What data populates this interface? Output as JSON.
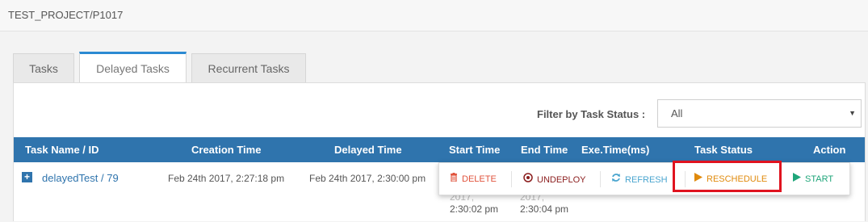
{
  "breadcrumb": "TEST_PROJECT/P1017",
  "tabs": [
    {
      "label": "Tasks",
      "active": false
    },
    {
      "label": "Delayed Tasks",
      "active": true
    },
    {
      "label": "Recurrent Tasks",
      "active": false
    }
  ],
  "filter": {
    "label": "Filter by Task Status :",
    "value": "All"
  },
  "table": {
    "headers": [
      "Task Name / ID",
      "Creation Time",
      "Delayed Time",
      "Start Time",
      "End Time",
      "Exe.Time(ms)",
      "Task Status",
      "Action"
    ],
    "rows": [
      {
        "task_name": "delayedTest",
        "separator": " / ",
        "task_id": "79",
        "creation_time": "Feb 24th 2017, 2:27:18 pm",
        "delayed_time": "Feb 24th 2017, 2:30:00 pm",
        "start_time_line1": "2017,",
        "start_time_line2": "2:30:02 pm",
        "end_time_line1": "2017,",
        "end_time_line2": "2:30:04 pm"
      }
    ]
  },
  "action_menu": {
    "delete": "DELETE",
    "undeploy": "UNDEPLOY",
    "refresh": "REFRESH",
    "reschedule": "RESCHEDULE",
    "start": "START"
  },
  "colors": {
    "header_blue": "#2f74ad",
    "tab_active_border": "#2b8ad2",
    "delete": "#e0533c",
    "undeploy": "#8b1d1d",
    "refresh": "#4aa5cf",
    "reschedule": "#e08a0c",
    "start": "#1fa67a",
    "highlight": "#e0131f"
  }
}
